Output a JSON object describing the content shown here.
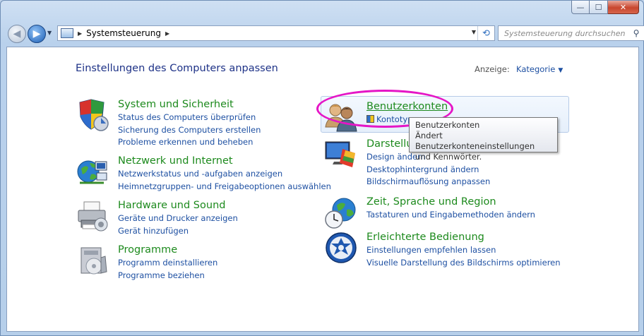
{
  "window": {
    "caption_buttons": {
      "minimize": "—",
      "maximize": "☐",
      "close": "✕"
    }
  },
  "nav": {
    "back_glyph": "◀",
    "forward_glyph": "▶",
    "address": {
      "separator": "▶",
      "crumb": "Systemsteuerung",
      "trailing_separator": "▶",
      "dropdown_glyph": "▼",
      "refresh_glyph": "⟲"
    },
    "search": {
      "placeholder": "Systemsteuerung durchsuchen",
      "icon_glyph": "⚲"
    }
  },
  "main": {
    "title": "Einstellungen des Computers anpassen",
    "view_label": "Anzeige:",
    "view_value": "Kategorie",
    "view_caret": "▼"
  },
  "categories_left": [
    {
      "icon": "shield-icon",
      "title": "System und Sicherheit",
      "links": [
        "Status des Computers überprüfen",
        "Sicherung des Computers erstellen",
        "Probleme erkennen und beheben"
      ]
    },
    {
      "icon": "network-icon",
      "title": "Netzwerk und Internet",
      "links": [
        "Netzwerkstatus und -aufgaben anzeigen",
        "Heimnetzgruppen- und Freigabeoptionen auswählen"
      ]
    },
    {
      "icon": "printer-icon",
      "title": "Hardware und Sound",
      "links": [
        "Geräte und Drucker anzeigen",
        "Gerät hinzufügen"
      ]
    },
    {
      "icon": "programs-icon",
      "title": "Programme",
      "links": [
        "Programm deinstallieren",
        "Programme beziehen"
      ]
    }
  ],
  "categories_right": [
    {
      "icon": "users-icon",
      "title": "Benutzerkonten",
      "links": [
        "Kontotyp"
      ]
    },
    {
      "icon": "display-icon",
      "title": "Darstellung",
      "links": [
        "Design ändern",
        "Desktophintergrund ändern",
        "Bildschirmauflösung anpassen"
      ]
    },
    {
      "icon": "globe-clock-icon",
      "title": "Zeit, Sprache und Region",
      "links": [
        "Tastaturen und Eingabemethoden ändern"
      ]
    },
    {
      "icon": "accessibility-icon",
      "title": "Erleichterte Bedienung",
      "links": [
        "Einstellungen empfehlen lassen",
        "Visuelle Darstellung des Bildschirms optimieren"
      ]
    }
  ],
  "tooltip": {
    "title": "Benutzerkonten",
    "line1": "Ändert Benutzerkonteneinstellungen",
    "line2": "und Kennwörter."
  },
  "colors": {
    "category_title": "#1d8a1d",
    "link": "#1e50a2",
    "highlight": "#e516c6"
  }
}
